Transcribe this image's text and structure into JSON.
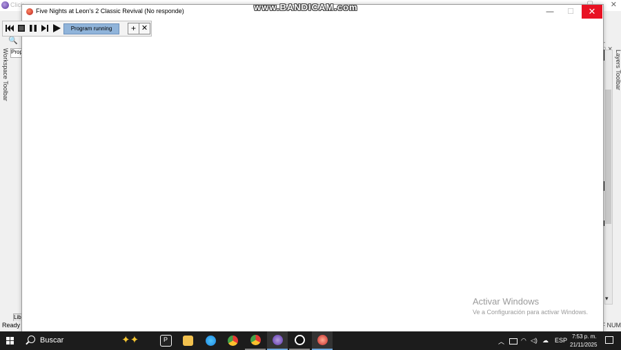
{
  "background_window": {
    "title": "Click",
    "panel_left": {
      "workspace_toolbar_label": "Workspace Toolbar",
      "properties_tab": "Prop",
      "library_tab": "Lib"
    },
    "panel_right": {
      "layers_toolbar_label": "Layers Toolbar"
    },
    "status": {
      "left": "Ready",
      "right": "CAF NUM"
    }
  },
  "app_window": {
    "title": "Five Nights at Leon's 2 Classic Revival (No responde)",
    "minimize": "—",
    "maximize": "☐",
    "close": "✕"
  },
  "debug_toolbar": {
    "status_label": "Program running",
    "add_label": "+",
    "close_label": "✕"
  },
  "watermarks": {
    "bandicam": "www.BANDICAM.com",
    "activate_title": "Activar Windows",
    "activate_subtitle": "Ve a Configuración para activar Windows."
  },
  "taskbar": {
    "search_label": "Buscar",
    "apps": [
      {
        "name": "picsart",
        "color": "#ffffff"
      },
      {
        "name": "file-explorer",
        "color": "#f2c14e"
      },
      {
        "name": "edge",
        "color": "#1e88e5"
      },
      {
        "name": "chrome",
        "color": "#e53935"
      },
      {
        "name": "chrome-profile",
        "color": "#43a047"
      },
      {
        "name": "clickteam",
        "color": "#7e57c2"
      },
      {
        "name": "bandicam",
        "color": "#e53935"
      },
      {
        "name": "game",
        "color": "#ff7043"
      }
    ],
    "tray": {
      "language": "ESP",
      "time": "7:53 p. m.",
      "date": "21/11/2025"
    }
  }
}
